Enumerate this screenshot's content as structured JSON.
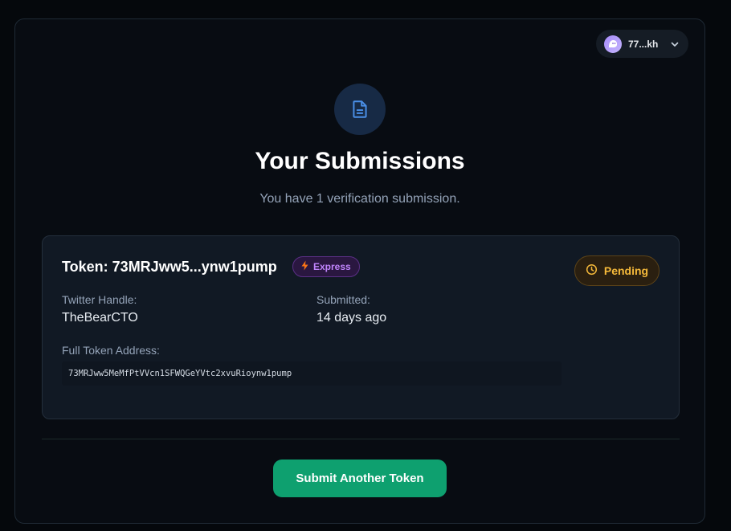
{
  "wallet": {
    "address_short": "77...kh"
  },
  "header": {
    "title": "Your Submissions",
    "subtitle": "You have 1 verification submission."
  },
  "submission": {
    "token_title": "Token: 73MRJww5...ynw1pump",
    "tier_badge": "Express",
    "status": "Pending",
    "twitter_label": "Twitter Handle:",
    "twitter_value": "TheBearCTO",
    "submitted_label": "Submitted:",
    "submitted_value": "14 days ago",
    "full_address_label": "Full Token Address:",
    "full_address_value": "73MRJww5MeMfPtVVcn1SFWQGeYVtc2xvuRioynw1pump"
  },
  "actions": {
    "submit_another": "Submit Another Token"
  },
  "colors": {
    "accent_green": "#0ea06f",
    "pending": "#f5b93a",
    "express": "#c084fc",
    "icon_blue": "#4a8fe7"
  },
  "icons": {
    "wallet_avatar": "ghost-icon",
    "wallet_chevron": "chevron-down-icon",
    "hero": "document-icon",
    "express": "lightning-icon",
    "pending": "clock-icon"
  }
}
